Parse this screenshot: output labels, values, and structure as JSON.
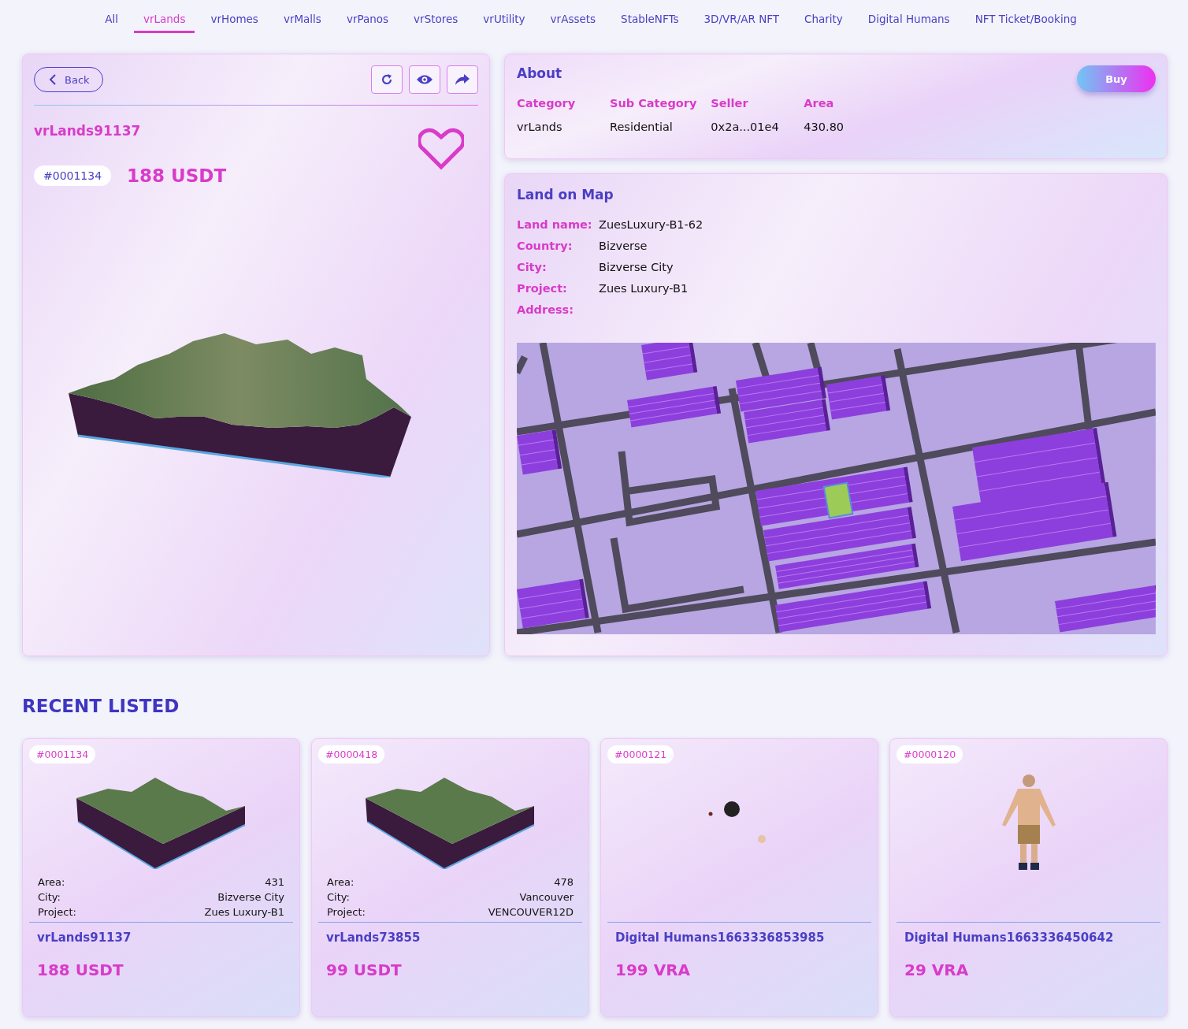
{
  "tabs": [
    {
      "label": "All",
      "selected": false
    },
    {
      "label": "vrLands",
      "selected": true
    },
    {
      "label": "vrHomes",
      "selected": false
    },
    {
      "label": "vrMalls",
      "selected": false
    },
    {
      "label": "vrPanos",
      "selected": false
    },
    {
      "label": "vrStores",
      "selected": false
    },
    {
      "label": "vrUtility",
      "selected": false
    },
    {
      "label": "vrAssets",
      "selected": false
    },
    {
      "label": "StableNFTs",
      "selected": false
    },
    {
      "label": "3D/VR/AR NFT",
      "selected": false
    },
    {
      "label": "Charity",
      "selected": false
    },
    {
      "label": "Digital Humans",
      "selected": false
    },
    {
      "label": "NFT Ticket/Booking",
      "selected": false
    }
  ],
  "detail": {
    "back_label": "Back",
    "name": "vrLands91137",
    "token_id": "#0001134",
    "price": "188 USDT"
  },
  "about": {
    "title": "About",
    "buy_label": "Buy",
    "columns": [
      {
        "label": "Category",
        "value": "vrLands"
      },
      {
        "label": "Sub Category",
        "value": "Residential"
      },
      {
        "label": "Seller",
        "value": "0x2a...01e4"
      },
      {
        "label": "Area",
        "value": "430.80"
      }
    ]
  },
  "land_on_map": {
    "title": "Land on Map",
    "fields": [
      {
        "label": "Land name:",
        "value": "ZuesLuxury-B1-62"
      },
      {
        "label": "Country:",
        "value": "Bizverse"
      },
      {
        "label": "City:",
        "value": "Bizverse City"
      },
      {
        "label": "Project:",
        "value": "Zues Luxury-B1"
      },
      {
        "label": "Address:"
      }
    ]
  },
  "recent_listed": {
    "title": "RECENT LISTED",
    "cards": [
      {
        "kind": "land",
        "token_id": "#0001134",
        "fields": [
          {
            "label": "Area:",
            "value": "431"
          },
          {
            "label": "City:",
            "value": "Bizverse City"
          },
          {
            "label": "Project:",
            "value": "Zues Luxury-B1"
          }
        ],
        "name": "vrLands91137",
        "price": "188 USDT"
      },
      {
        "kind": "land",
        "token_id": "#0000418",
        "fields": [
          {
            "label": "Area:",
            "value": "478"
          },
          {
            "label": "City:",
            "value": "Vancouver"
          },
          {
            "label": "Project:",
            "value": "VENCOUVER12D"
          }
        ],
        "name": "vrLands73855",
        "price": "99 USDT"
      },
      {
        "kind": "head",
        "token_id": "#0000121",
        "name": "Digital Humans1663336853985",
        "price": "199 VRA"
      },
      {
        "kind": "figure",
        "token_id": "#0000120",
        "name": "Digital Humans1663336450642",
        "price": "29 VRA"
      }
    ]
  }
}
